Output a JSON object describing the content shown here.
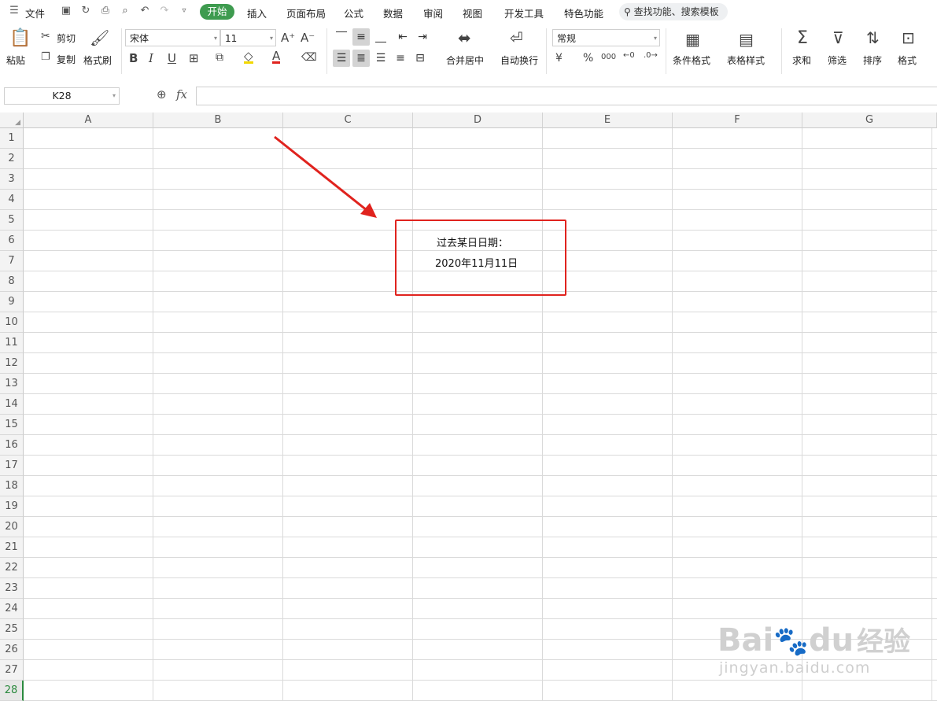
{
  "menu": {
    "file": "文件",
    "tabs": [
      "开始",
      "插入",
      "页面布局",
      "公式",
      "数据",
      "审阅",
      "视图",
      "开发工具",
      "特色功能"
    ],
    "active_tab": "开始",
    "search": "查找功能、搜索模板"
  },
  "ribbon": {
    "paste": "粘贴",
    "cut": "剪切",
    "copy": "复制",
    "format_painter": "格式刷",
    "font_name": "宋体",
    "font_size": "11",
    "merge_center": "合并居中",
    "wrap_text": "自动换行",
    "number_format": "常规",
    "currency_symbol": "¥",
    "percent_symbol": "%",
    "thousands_symbol": "000",
    "cond_format": "条件格式",
    "table_style": "表格样式",
    "sum": "求和",
    "filter": "筛选",
    "sort": "排序",
    "format": "格式",
    "bold": "B",
    "italic": "I",
    "underline": "U",
    "font_color_glyph": "A"
  },
  "formula_bar": {
    "name_box": "K28",
    "fx": "fx",
    "content": ""
  },
  "sheet": {
    "columns": [
      "A",
      "B",
      "C",
      "D",
      "E",
      "F",
      "G"
    ],
    "rows": [
      "1",
      "2",
      "3",
      "4",
      "5",
      "6",
      "7",
      "8",
      "9",
      "10",
      "11",
      "12",
      "13",
      "14",
      "15",
      "16",
      "17",
      "18",
      "19",
      "20",
      "21",
      "22",
      "23",
      "24",
      "25",
      "26",
      "27",
      "28"
    ],
    "selected_row": "28",
    "cell_d6": "过去某日日期：",
    "cell_d7": "2020年11月11日"
  },
  "watermark": {
    "brand": "Bai",
    "brand2": "du",
    "product": "经验",
    "url": "jingyan.baidu.com"
  },
  "colors": {
    "accent_green": "#3e9b4f",
    "annotation_red": "#e0231e"
  }
}
